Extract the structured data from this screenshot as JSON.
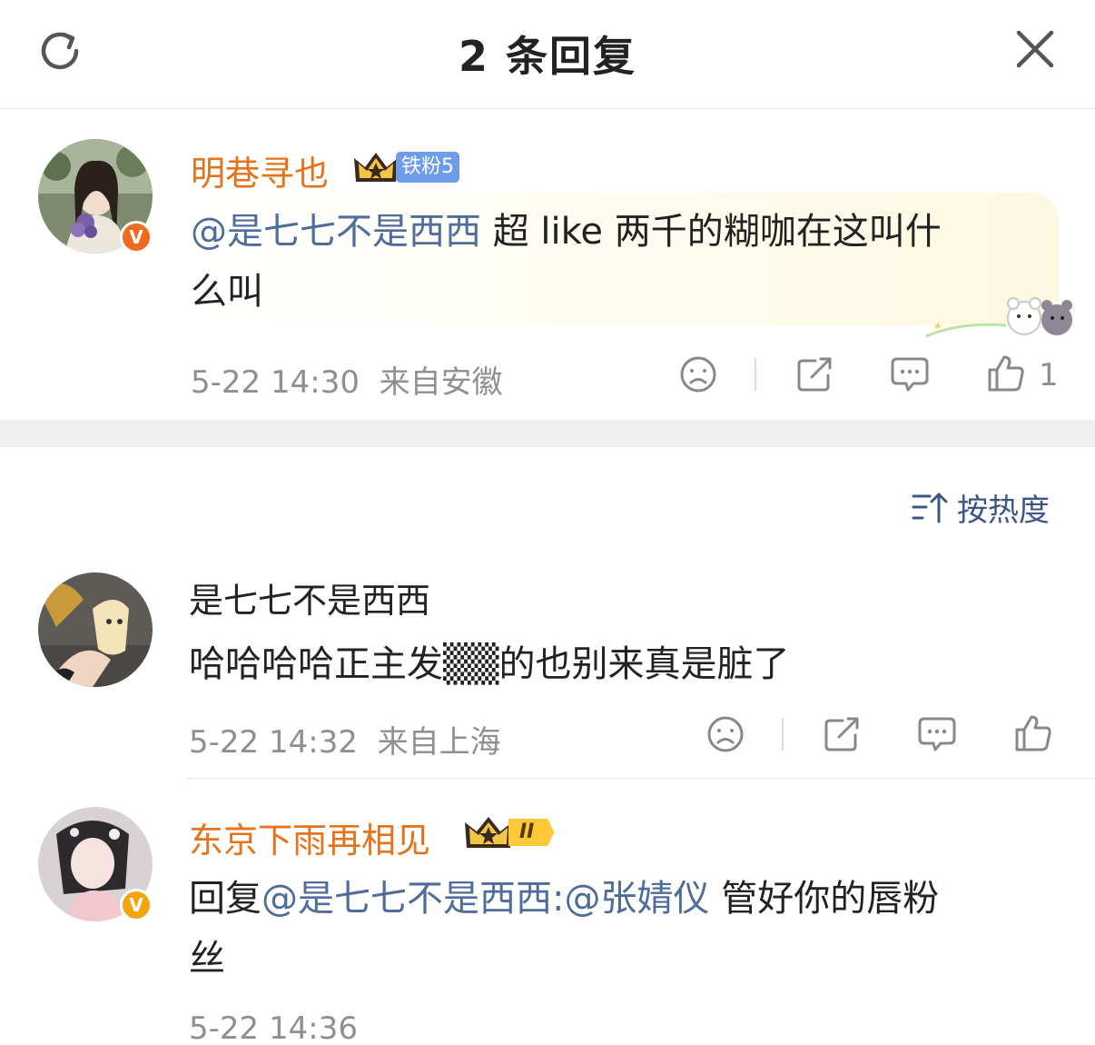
{
  "header": {
    "title": "2 条回复",
    "refresh_icon": "refresh-icon",
    "close_icon": "close-icon"
  },
  "main_comment": {
    "username": "明巷寻也",
    "fan_badge": "铁粉5",
    "mention": "@是七七不是西西",
    "text_line1": " 超 like 两千的糊咖在这叫什",
    "text_line2": "么叫",
    "time": "5-22 14:30",
    "location": "来自安徽",
    "like_count": "1"
  },
  "sort": {
    "label": "按热度"
  },
  "replies": [
    {
      "username": "是七七不是西西",
      "text": "哈哈哈哈正主发▒▒的也别来真是脏了",
      "time": "5-22 14:32",
      "location": "来自上海"
    },
    {
      "username": "东京下雨再相见",
      "level_badge": "II",
      "reply_prefix": "回复",
      "mention": "@是七七不是西西",
      "mention2": ":@张婧仪",
      "text_line1": " 管好你的唇粉",
      "text_line2": "丝",
      "time": "5-22 14:36"
    }
  ],
  "colors": {
    "username": "#e5731b",
    "mention": "#4f6d9b",
    "meta": "#8f8f8f",
    "fan_badge": "#6d9ce8",
    "level_badge": "#ffc83a"
  }
}
